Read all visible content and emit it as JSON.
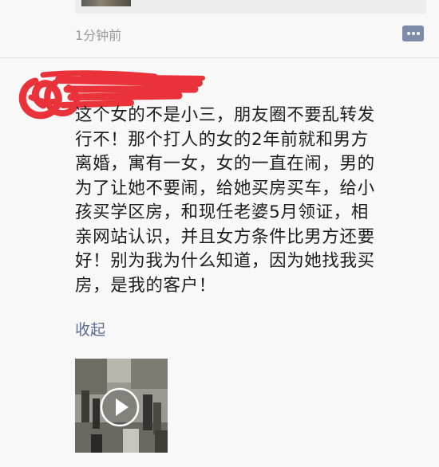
{
  "previous_post": {
    "timestamp": "1分钟前",
    "comment_icon": "comment-icon"
  },
  "post": {
    "author_redacted": true,
    "lines": [
      "这个女的不是小三，朋友圈不要乱转发",
      "行不！那个打人的女的2年前就和男方",
      "离婚，寓有一女，女的一直在闹，男的",
      "为了让她不要闹，给她买房买车，给小",
      "孩买学区房，和现任老婆5月领证，相",
      "亲网站认识，并且女方条件比男方还要",
      "好！别为我为什么知道，因为她找我买",
      "房，是我的客户！"
    ],
    "collapse_label": "收起",
    "video_icon": "play-icon"
  },
  "colors": {
    "link": "#5b6b92",
    "timestamp": "#9a9a9a",
    "redaction": "#e8222a",
    "comment_button": "#7e8ca8"
  }
}
